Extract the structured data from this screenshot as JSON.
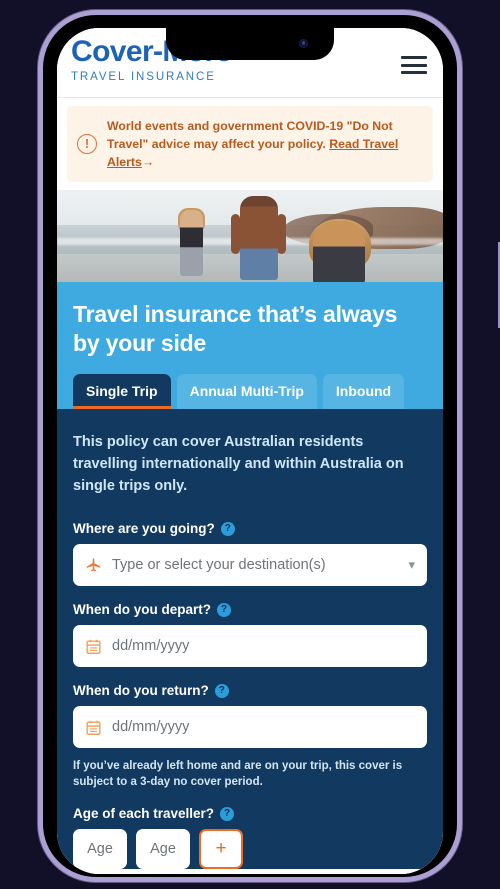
{
  "device": {
    "type": "smartphone-mockup",
    "frame_color": "#ac9fd4",
    "background_color": "#120f28"
  },
  "header": {
    "logo_primary": "Cover-More",
    "logo_subtitle": "TRAVEL INSURANCE",
    "logo_color": "#1d63b3",
    "menu_icon": "hamburger-menu-icon"
  },
  "alert": {
    "icon": "exclamation-circle-icon",
    "text_before": "World events and government COVID-19 \"Do Not Travel\" advice may affect your policy. ",
    "link_text": "Read Travel Alerts",
    "arrow": "→",
    "background_color": "#fdf3e6",
    "text_color": "#b95a1e"
  },
  "hero": {
    "image_alt": "Three people walking on a beach by the ocean",
    "title": "Travel insurance that’s always by your side",
    "band_color": "#3eaae0",
    "tabs": [
      {
        "label": "Single Trip",
        "active": true
      },
      {
        "label": "Annual Multi-Trip",
        "active": false
      },
      {
        "label": "Inbound",
        "active": false
      }
    ],
    "active_tab_underline_color": "#ef6b21"
  },
  "form": {
    "background_color": "#123a61",
    "intro": "This policy can cover Australian residents travelling internationally and within Australia on single trips only.",
    "help_icon_glyph": "?",
    "fields": [
      {
        "id": "destination",
        "label": "Where are you going?",
        "icon": "airplane-icon",
        "placeholder": "Type or select your destination(s)",
        "value": "",
        "has_dropdown": true,
        "dropdown_icon": "chevron-down-icon"
      },
      {
        "id": "depart-date",
        "label": "When do you depart?",
        "icon": "calendar-icon",
        "placeholder": "dd/mm/yyyy",
        "value": ""
      },
      {
        "id": "return-date",
        "label": "When do you return?",
        "icon": "calendar-icon",
        "placeholder": "dd/mm/yyyy",
        "value": "",
        "note": "If you’ve already left home and are on your trip, this cover is subject to a 3-day no cover period."
      }
    ],
    "age_section": {
      "label": "Age of each traveller?",
      "traveller_placeholders": [
        "Age",
        "Age"
      ],
      "add_button_label": "+",
      "add_button_border_color": "#ef6b21"
    }
  }
}
